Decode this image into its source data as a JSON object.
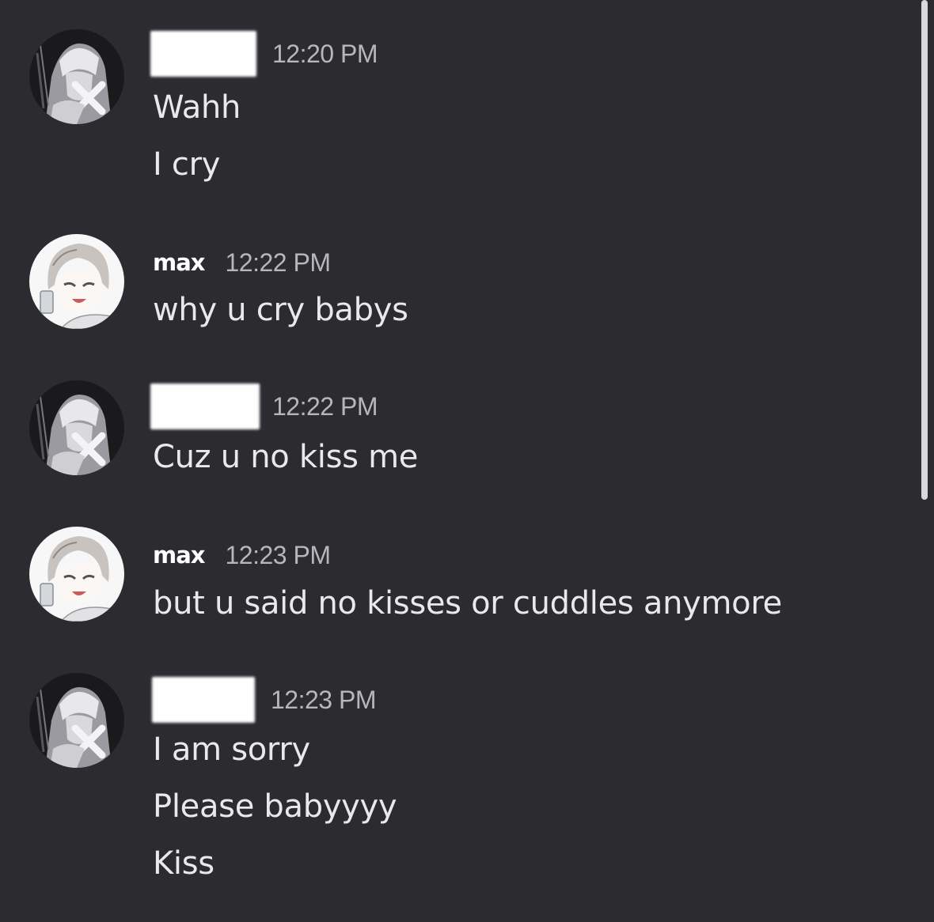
{
  "messages": [
    {
      "author": "",
      "author_redacted": true,
      "avatar": "anime-boy-monochrome-avatar",
      "timestamp": "12:20 PM",
      "lines": [
        "Wahh",
        "I cry"
      ]
    },
    {
      "author": "max",
      "author_redacted": false,
      "avatar": "anime-boy-smiling-avatar",
      "timestamp": "12:22 PM",
      "lines": [
        "why u cry babys"
      ]
    },
    {
      "author": "",
      "author_redacted": true,
      "avatar": "anime-boy-monochrome-avatar",
      "timestamp": "12:22 PM",
      "lines": [
        "Cuz u no kiss me"
      ]
    },
    {
      "author": "max",
      "author_redacted": false,
      "avatar": "anime-boy-smiling-avatar",
      "timestamp": "12:23 PM",
      "lines": [
        "but u said no kisses or cuddles anymore"
      ]
    },
    {
      "author": "",
      "author_redacted": true,
      "avatar": "anime-boy-monochrome-avatar",
      "timestamp": "12:23 PM",
      "lines": [
        "I am sorry",
        "Please babyyyy",
        "Kiss"
      ]
    }
  ],
  "colors": {
    "background": "#2b2b30",
    "message_text": "#e9e9ec",
    "timestamp_text": "#b6b7bd",
    "username_text": "#ffffff",
    "scrollbar": "#d9d9dd"
  }
}
